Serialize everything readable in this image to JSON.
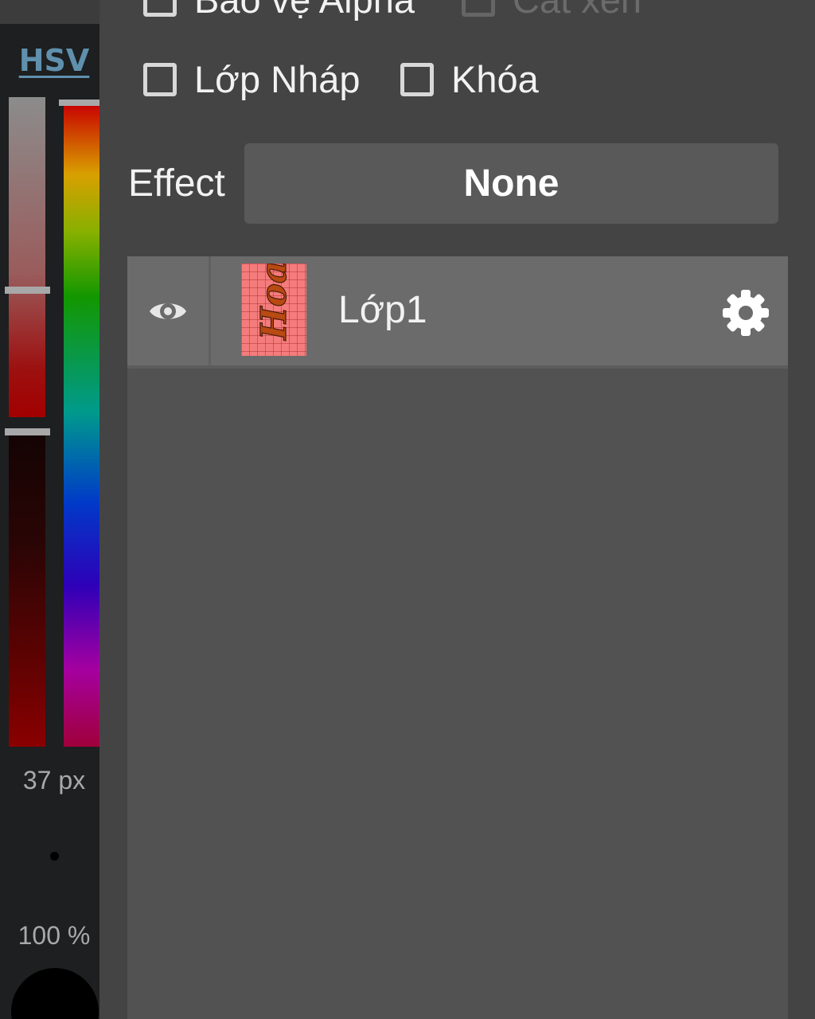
{
  "color_panel": {
    "mode_tab": "HSV",
    "brush_size": "37 px",
    "opacity": "100 %",
    "current_color": "#000000",
    "hue_color": "#c80000"
  },
  "layer_options": {
    "checkboxes": [
      {
        "label": "Bảo vệ Alpha",
        "checked": false,
        "enabled": true
      },
      {
        "label": "Cắt xén",
        "checked": false,
        "enabled": false
      },
      {
        "label": "Lớp Nháp",
        "checked": false,
        "enabled": true
      },
      {
        "label": "Khóa",
        "checked": false,
        "enabled": true
      }
    ],
    "effect_label": "Effect",
    "effect_value": "None"
  },
  "layers": [
    {
      "name": "Lớp1",
      "visible": true,
      "thumbnail_color": "#f57c7c",
      "thumbnail_text": "Hoa"
    }
  ]
}
